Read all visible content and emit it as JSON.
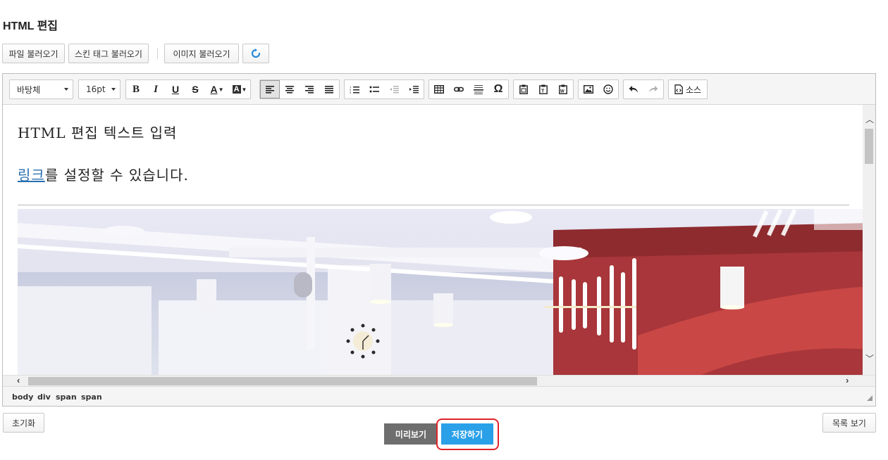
{
  "page": {
    "title": "HTML 편집"
  },
  "top_buttons": {
    "load_file": "파일 불러오기",
    "load_skin_tag": "스킨 태그 불러오기",
    "load_image": "이미지 불러오기"
  },
  "toolbar": {
    "font_family": "바탕체",
    "font_size": "16pt",
    "bold": "B",
    "italic": "I",
    "underline": "U",
    "strike": "S",
    "font_color": "A",
    "bg_color": "A",
    "special_char": "Ω",
    "source_label": "소스"
  },
  "content": {
    "line1": "HTML 편집 텍스트 입력",
    "link_text": "링크",
    "line2_rest": "를 설정할 수 있습니다."
  },
  "statusbar": {
    "path": [
      "body",
      "div",
      "span",
      "span"
    ]
  },
  "bottom": {
    "reset": "초기화",
    "preview": "미리보기",
    "save": "저장하기",
    "list": "목록 보기"
  },
  "colors": {
    "accent_blue": "#2aa0e8",
    "preview_gray": "#6e6e6e",
    "highlight_red": "#e0232a",
    "link_blue": "#2a6fb0"
  }
}
